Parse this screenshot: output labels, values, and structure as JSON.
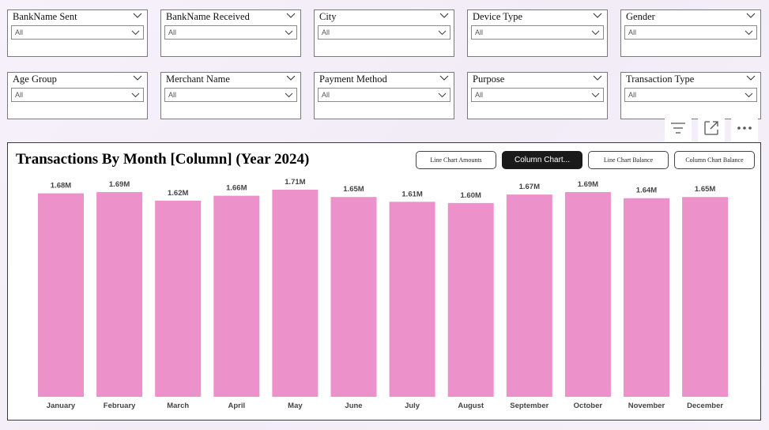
{
  "slicers": [
    {
      "title": "BankName Sent",
      "value": "All"
    },
    {
      "title": "BankName Received",
      "value": "All"
    },
    {
      "title": "City",
      "value": "All"
    },
    {
      "title": "Device Type",
      "value": "All"
    },
    {
      "title": "Gender",
      "value": "All"
    },
    {
      "title": "Age Group",
      "value": "All"
    },
    {
      "title": "Merchant Name",
      "value": "All"
    },
    {
      "title": "Payment Method",
      "value": "All"
    },
    {
      "title": "Purpose",
      "value": "All"
    },
    {
      "title": "Transaction Type",
      "value": "All"
    }
  ],
  "toolbar": {
    "icons": [
      "filter-icon",
      "focus-mode-icon",
      "more-options-icon"
    ]
  },
  "visual": {
    "buttons": [
      {
        "label": "Line Chart Amounts",
        "active": false
      },
      {
        "label": "Column Chart...",
        "active": true
      },
      {
        "label": "Line Chart Balance",
        "active": false
      },
      {
        "label": "Column Chart Balance",
        "active": false
      }
    ]
  },
  "colors": {
    "bar": "#ec91c9",
    "label": "#444444"
  },
  "chart_data": {
    "type": "bar",
    "title": "Transactions By Month [Column] (Year 2024)",
    "categories": [
      "January",
      "February",
      "March",
      "April",
      "May",
      "June",
      "July",
      "August",
      "September",
      "October",
      "November",
      "December"
    ],
    "values": [
      1.68,
      1.69,
      1.62,
      1.66,
      1.71,
      1.65,
      1.61,
      1.6,
      1.67,
      1.69,
      1.64,
      1.65
    ],
    "data_labels": [
      "1.68M",
      "1.69M",
      "1.62M",
      "1.66M",
      "1.71M",
      "1.65M",
      "1.61M",
      "1.60M",
      "1.67M",
      "1.69M",
      "1.64M",
      "1.65M"
    ],
    "unit": "M",
    "ylim": [
      0,
      1.71
    ],
    "grid": false,
    "legend": "none"
  }
}
